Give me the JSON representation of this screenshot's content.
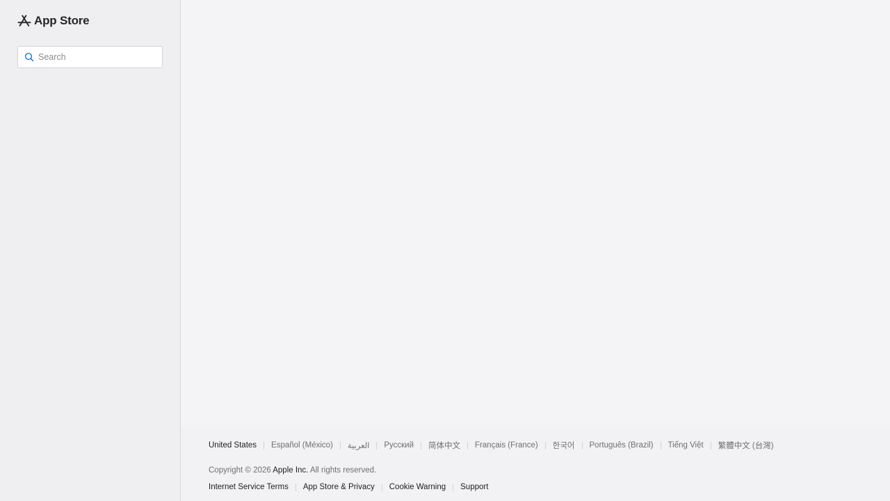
{
  "sidebar": {
    "brand": {
      "icon": "app-store-icon",
      "label": "App Store"
    },
    "search": {
      "icon": "search-icon",
      "placeholder": "Search",
      "value": ""
    }
  },
  "footer": {
    "languages": [
      "United States",
      "Español (México)",
      "العربية",
      "Русский",
      "简体中文",
      "Français (France)",
      "한국어",
      "Português (Brazil)",
      "Tiếng Việt",
      "繁體中文 (台灣)"
    ],
    "copyright": {
      "prefix": "Copyright © 2026",
      "company": "Apple Inc.",
      "suffix": "All rights reserved."
    },
    "links": [
      "Internet Service Terms",
      "App Store & Privacy",
      "Cookie Warning",
      "Support"
    ]
  },
  "colors": {
    "sidebar_bg": "#efeff1",
    "main_bg": "#f4f4f6",
    "search_icon": "#0071e3",
    "text_primary": "#1d1d1f",
    "text_secondary": "#6e6e73"
  }
}
